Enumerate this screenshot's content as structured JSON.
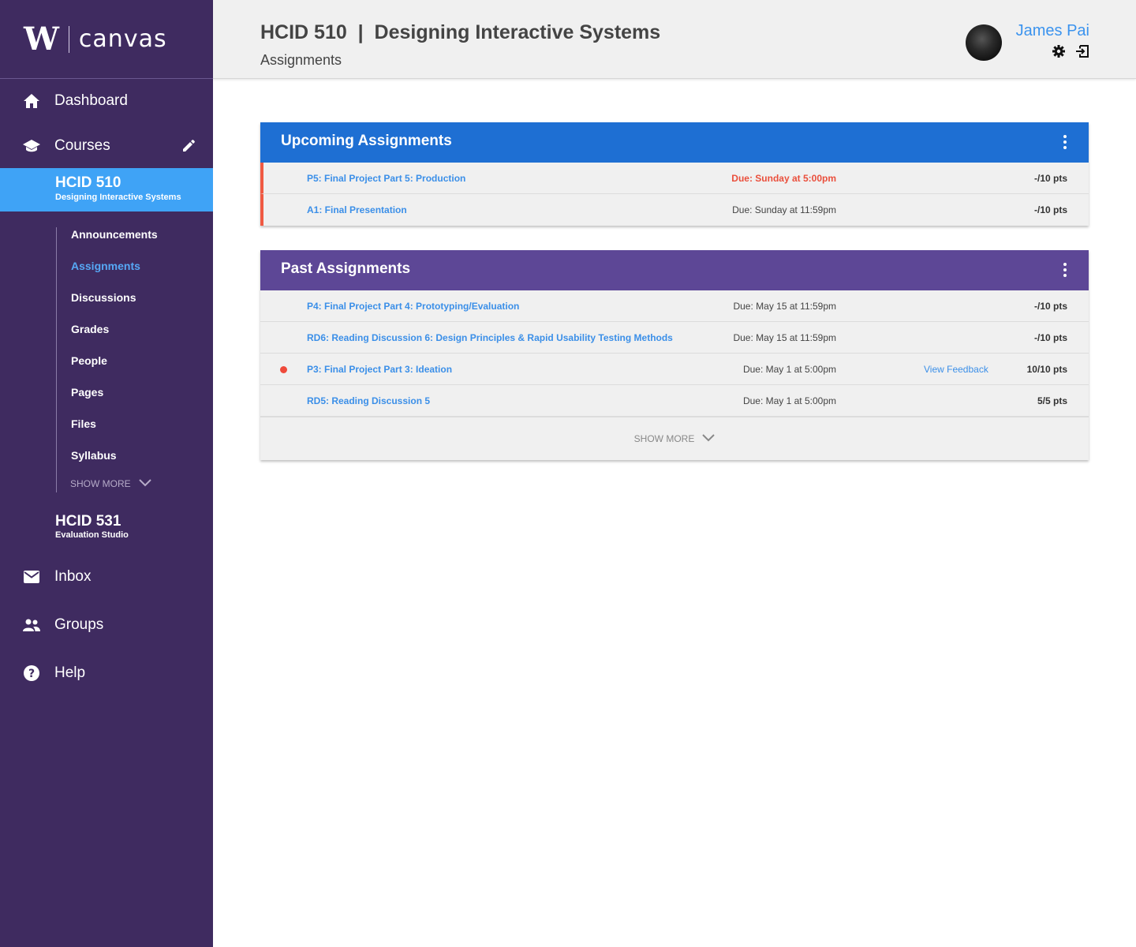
{
  "brand": {
    "logo_letter": "W",
    "name": "canvas"
  },
  "colors": {
    "sidebar_bg": "#3f2b60",
    "active_course_bg": "#3fa3f6",
    "upcoming_header": "#1e6fd3",
    "past_header": "#5d4796",
    "link": "#3b8fe8",
    "alert": "#ea4f3c"
  },
  "sidebar": {
    "dashboard": {
      "label": "Dashboard",
      "icon": "home-icon"
    },
    "courses": {
      "label": "Courses",
      "icon": "graduation-cap-icon",
      "edit_icon": "pencil-icon"
    },
    "active_course": {
      "code": "HCID 510",
      "name": "Designing Interactive Systems"
    },
    "subnav": [
      "Announcements",
      "Assignments",
      "Discussions",
      "Grades",
      "People",
      "Pages",
      "Files",
      "Syllabus"
    ],
    "subnav_active": "Assignments",
    "subnav_more": "SHOW MORE",
    "other_course": {
      "code": "HCID 531",
      "name": "Evaluation Studio"
    },
    "inbox": {
      "label": "Inbox",
      "icon": "mail-icon"
    },
    "groups": {
      "label": "Groups",
      "icon": "people-icon"
    },
    "help": {
      "label": "Help",
      "icon": "help-icon"
    }
  },
  "header": {
    "title": "HCID 510  |  Designing Interactive Systems",
    "subtitle": "Assignments",
    "user_name": "James Pai",
    "settings_icon": "gear-icon",
    "logout_icon": "logout-icon"
  },
  "upcoming": {
    "title": "Upcoming Assignments",
    "rows": [
      {
        "title": "P5: Final Project Part 5: Production",
        "due": "Due: Sunday at 5:00pm",
        "points": "-/10 pts"
      },
      {
        "title": "A1: Final Presentation",
        "due": "Due: Sunday at 11:59pm",
        "points": "-/10 pts"
      }
    ]
  },
  "past": {
    "title": "Past Assignments",
    "rows": [
      {
        "title": "P4: Final Project Part 4: Prototyping/Evaluation",
        "due": "Due: May 15 at 11:59pm",
        "feedback": "",
        "points": "-/10 pts"
      },
      {
        "title": "RD6: Reading Discussion 6: Design Principles & Rapid Usability Testing Methods",
        "due": "Due: May 15 at 11:59pm",
        "feedback": "",
        "points": "-/10 pts"
      },
      {
        "title": "P3: Final Project Part 3: Ideation",
        "due": "Due: May 1 at 5:00pm",
        "feedback": "View Feedback",
        "points": "10/10 pts"
      },
      {
        "title": "RD5: Reading Discussion 5",
        "due": "Due: May 1 at 5:00pm",
        "feedback": "",
        "points": "5/5 pts"
      }
    ],
    "show_more": "SHOW MORE"
  }
}
